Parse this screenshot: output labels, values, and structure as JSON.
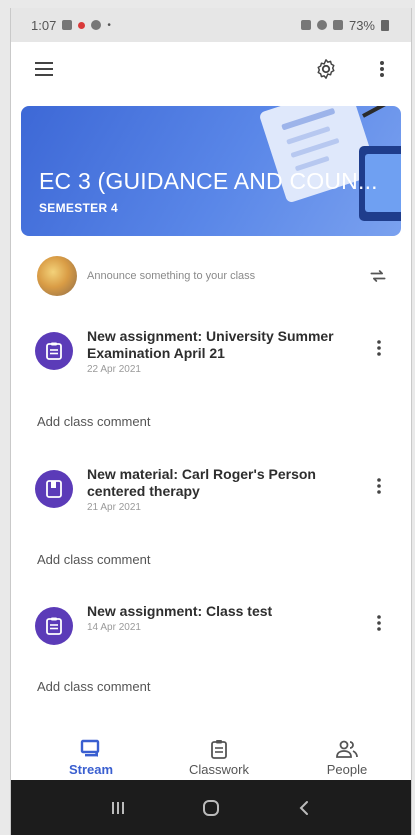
{
  "status_bar": {
    "time": "1:07",
    "battery": "73%"
  },
  "app_bar": {
    "menu_icon": "hamburger-menu-icon",
    "settings_icon": "gear-icon",
    "more_icon": "vertical-dots-icon"
  },
  "class_banner": {
    "title": "EC 3 (GUIDANCE AND COUN...",
    "subtitle": "SEMESTER 4",
    "color": "#4a74de"
  },
  "announce": {
    "placeholder": "Announce something to your class",
    "repost_icon": "repost-icon"
  },
  "posts": [
    {
      "type_icon": "assignment-icon",
      "title": "New assignment: University Summer Examination April 21",
      "date": "22 Apr 2021",
      "comment_label": "Add class comment"
    },
    {
      "type_icon": "material-icon",
      "title": "New material: Carl Roger's Person centered therapy",
      "date": "21 Apr 2021",
      "comment_label": "Add class comment"
    },
    {
      "type_icon": "assignment-icon",
      "title": "New assignment: Class test",
      "date": "14 Apr 2021",
      "comment_label": "Add class comment"
    }
  ],
  "bottom_nav": [
    {
      "label": "Stream",
      "icon": "stream-icon",
      "active": true
    },
    {
      "label": "Classwork",
      "icon": "classwork-icon",
      "active": false
    },
    {
      "label": "People",
      "icon": "people-icon",
      "active": false
    }
  ],
  "system_nav": {
    "recents_icon": "recents-icon",
    "home_icon": "home-icon",
    "back_icon": "back-icon"
  },
  "colors": {
    "accent": "#3a5fd0",
    "post_icon_bg": "#5b3bb8"
  }
}
